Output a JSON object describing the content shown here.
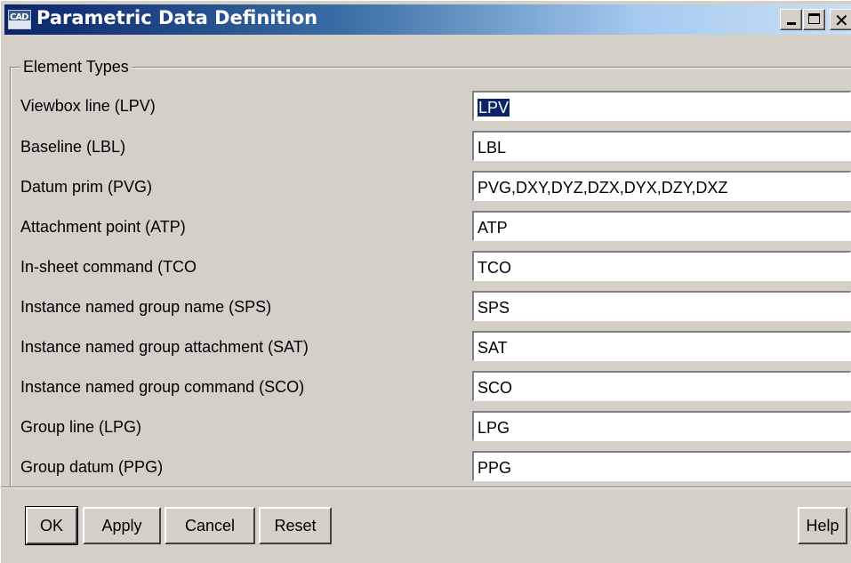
{
  "window": {
    "title": "Parametric Data Definition",
    "icon_text": "CAD"
  },
  "group": {
    "label": "Element Types"
  },
  "rows": [
    {
      "label": "Viewbox line (LPV)",
      "value": "LPV"
    },
    {
      "label": "Baseline (LBL)",
      "value": "LBL"
    },
    {
      "label": "Datum prim (PVG)",
      "value": "PVG,DXY,DYZ,DZX,DYX,DZY,DXZ"
    },
    {
      "label": "Attachment point (ATP)",
      "value": "ATP"
    },
    {
      "label": "In-sheet command (TCO",
      "value": "TCO"
    },
    {
      "label": "Instance named group name (SPS)",
      "value": "SPS"
    },
    {
      "label": "Instance named group attachment (SAT)",
      "value": "SAT"
    },
    {
      "label": "Instance named group command (SCO)",
      "value": "SCO"
    },
    {
      "label": "Group line (LPG)",
      "value": "LPG"
    },
    {
      "label": "Group datum (PPG)",
      "value": "PPG"
    }
  ],
  "buttons": {
    "ok": "OK",
    "apply": "Apply",
    "cancel": "Cancel",
    "reset": "Reset",
    "help": "Help"
  }
}
